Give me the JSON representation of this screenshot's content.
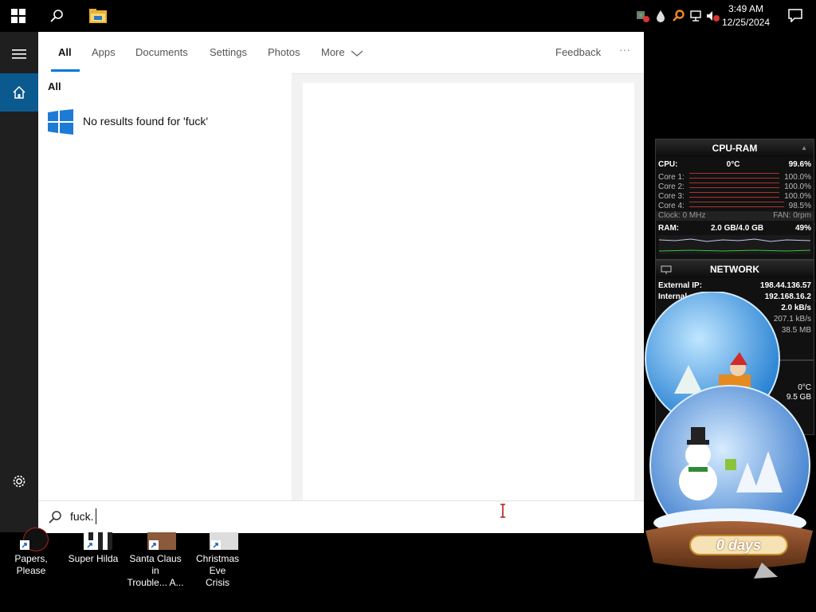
{
  "taskbar": {
    "start_icon": "windows-logo-icon",
    "search_icon": "search-icon",
    "explorer_icon": "folder-icon",
    "tray_icons": [
      "network-game-icon",
      "water-drop-icon",
      "search-orange-icon",
      "network-icon",
      "volume-muted-icon"
    ],
    "time": "3:49 AM",
    "date": "12/25/2024",
    "notification_icon": "action-center-icon"
  },
  "search": {
    "tabs": [
      "All",
      "Apps",
      "Documents",
      "Settings",
      "Photos",
      "More"
    ],
    "active_tab": "All",
    "feedback_label": "Feedback",
    "more_options_label": "···",
    "section_heading": "All",
    "no_results_text": "No results found for 'fuck'",
    "query": "fuck."
  },
  "rail": {
    "menu_icon": "hamburger-icon",
    "home_icon": "home-icon",
    "settings_icon": "gear-icon"
  },
  "desktop_icons": [
    {
      "label_line1": "Papers, Please",
      "label_line2": ""
    },
    {
      "label_line1": "Super Hilda",
      "label_line2": ""
    },
    {
      "label_line1": "Santa Claus in",
      "label_line2": "Trouble... A..."
    },
    {
      "label_line1": "Christmas Eve",
      "label_line2": "Crisis"
    }
  ],
  "cpu_gadget": {
    "title": "CPU-RAM",
    "cpu_label": "CPU:",
    "cpu_temp": "0°C",
    "cpu_usage": "99.6%",
    "cores": [
      {
        "label": "Core 1:",
        "value": "100.0%"
      },
      {
        "label": "Core 2:",
        "value": "100.0%"
      },
      {
        "label": "Core 3:",
        "value": "100.0%"
      },
      {
        "label": "Core 4:",
        "value": "98.5%"
      }
    ],
    "clock_label": "Clock: 0 MHz",
    "fan_label": "FAN: 0rpm",
    "ram_label": "RAM:",
    "ram_used": "2.0 GB/4.0 GB",
    "ram_percent": "49%"
  },
  "network_gadget": {
    "title": "NETWORK",
    "external_ip_label": "External IP:",
    "external_ip": "198.44.136.57",
    "internal_ip_label": "Internal",
    "internal_ip": "192.168.16.2",
    "upload_rate": "2.0 kB/s",
    "download_rate": "207.1 kB/s",
    "total": "38.5 MB"
  },
  "extra_gadget": {
    "temp": "0°C",
    "value": "9.5 GB"
  },
  "snow_globe": {
    "days_text": "0 days"
  },
  "colors": {
    "accent": "#0078d7",
    "windows_blue": "#1d7bd6",
    "cursor_red": "#b0201a"
  }
}
